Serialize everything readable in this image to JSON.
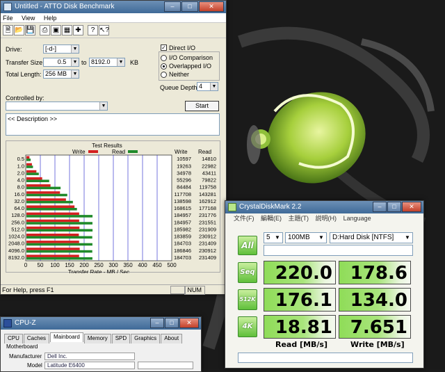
{
  "atto": {
    "title": "Untitled - ATTO Disk Benchmark",
    "menu": [
      "File",
      "View",
      "Help"
    ],
    "drive_label": "Drive:",
    "drive_value": "[-d-]",
    "transfer_size_label": "Transfer Size:",
    "transfer_from": "0.5",
    "transfer_to_label": "to",
    "transfer_to": "8192.0",
    "transfer_unit": "KB",
    "total_length_label": "Total Length:",
    "total_length_value": "256 MB",
    "direct_io_label": "Direct I/O",
    "direct_io_checked": true,
    "io_comparison_label": "I/O Comparison",
    "overlapped_io_label": "Overlapped I/O",
    "neither_label": "Neither",
    "selected_mode": "Overlapped I/O",
    "queue_depth_label": "Queue Depth:",
    "queue_depth_value": "4",
    "controlled_by_label": "Controlled by:",
    "controlled_by_value": "",
    "start_label": "Start",
    "description_text": "<< Description >>",
    "status_text": "For Help, press F1",
    "status_num": "NUM"
  },
  "chart_data": {
    "type": "bar",
    "title": "Test Results",
    "xlabel": "Transfer Rate - MB / Sec",
    "ylabel": "",
    "xlim": [
      0,
      500
    ],
    "x_ticks": [
      "0",
      "50",
      "100",
      "150",
      "200",
      "250",
      "300",
      "350",
      "400",
      "450",
      "500"
    ],
    "categories": [
      "0.5",
      "1.0",
      "2.0",
      "4.0",
      "8.0",
      "16.0",
      "32.0",
      "64.0",
      "128.0",
      "256.0",
      "512.0",
      "1024.0",
      "2048.0",
      "4096.0",
      "8192.0"
    ],
    "series": [
      {
        "name": "Write",
        "color": "#d42020",
        "values": [
          10597,
          19263,
          34978,
          55296,
          84484,
          117708,
          138598,
          168615,
          184957,
          184957,
          185982,
          183859,
          184703,
          186846,
          184703
        ]
      },
      {
        "name": "Read",
        "color": "#1f8a2a",
        "values": [
          14810,
          22982,
          43411,
          79822,
          119758,
          143281,
          162912,
          177168,
          231776,
          231551,
          231909,
          230912,
          231409,
          230912,
          231409
        ]
      }
    ],
    "value_unit": "KB/sec",
    "write_col_label": "Write",
    "read_col_label": "Read",
    "grid": true,
    "legend": "top"
  },
  "cdm": {
    "title": "CrystalDiskMark 2.2",
    "menu": [
      "文件(F)",
      "編輯(E)",
      "主題(T)",
      "説明(H)",
      "Language"
    ],
    "runs": "5",
    "size": "100MB",
    "drive": "D:Hard Disk [NTFS]",
    "all_label": "All",
    "tests": [
      {
        "label": "Seq",
        "read": "220.0",
        "write": "178.6"
      },
      {
        "label": "512K",
        "read": "176.1",
        "write": "134.0"
      },
      {
        "label": "4K",
        "read": "18.81",
        "write": "7.651"
      }
    ],
    "read_col": "Read [MB/s]",
    "write_col": "Write [MB/s]",
    "accent": "#5fbf3a"
  },
  "cpuz": {
    "title": "CPU-Z",
    "tabs": [
      "CPU",
      "Caches",
      "Mainboard",
      "Memory",
      "SPD",
      "Graphics",
      "About"
    ],
    "active_tab": "Mainboard",
    "section": "Motherboard",
    "manufacturer_label": "Manufacturer",
    "manufacturer_value": "Dell Inc.",
    "model_label": "Model",
    "model_value": "Latitude E6400"
  }
}
